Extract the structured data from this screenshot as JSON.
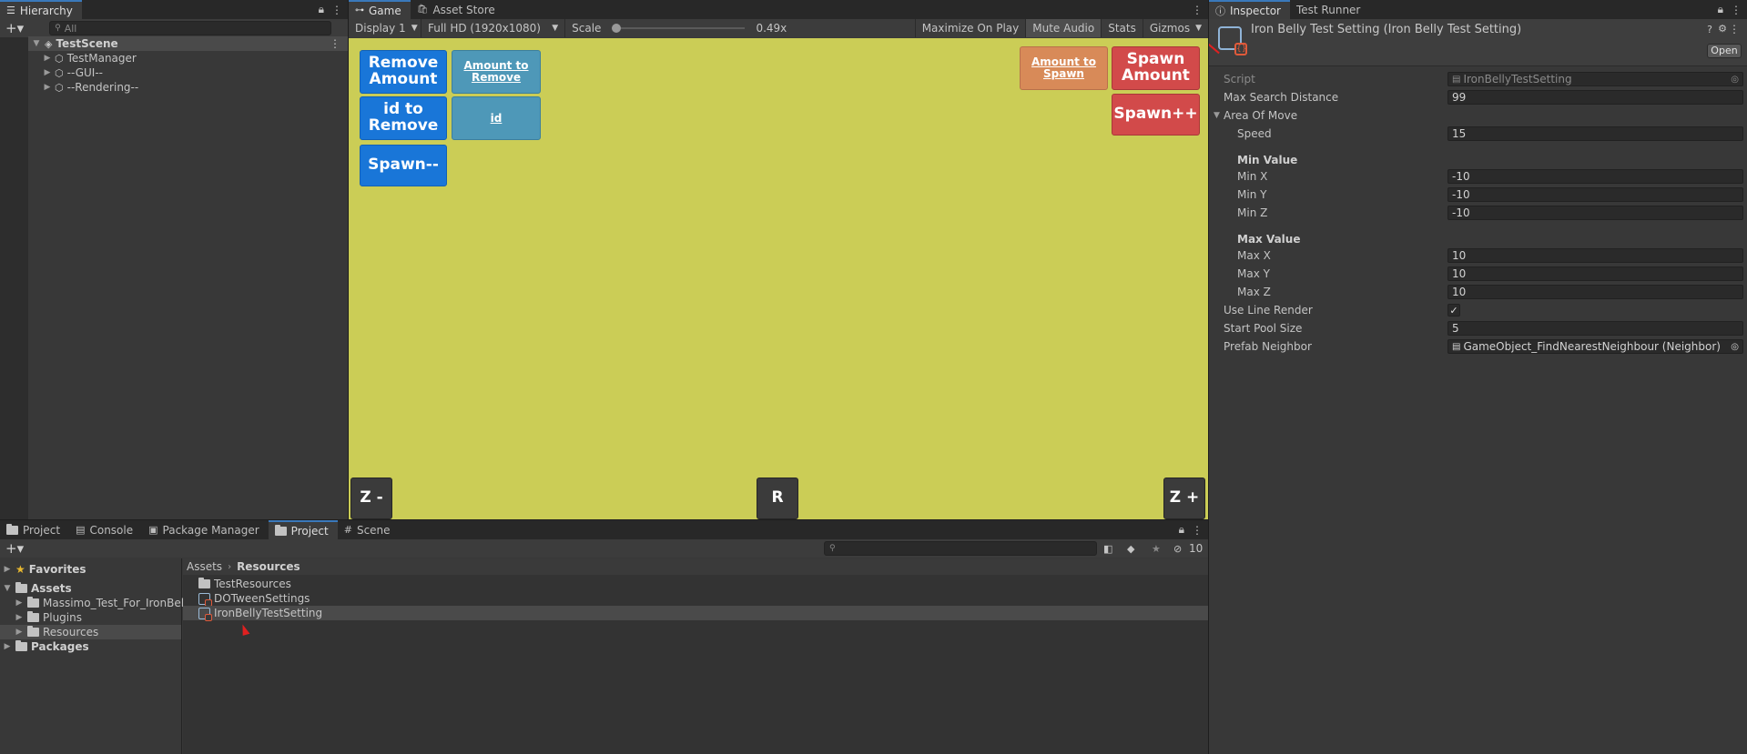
{
  "hierarchy": {
    "tab_label": "Hierarchy",
    "search_placeholder": "All",
    "items": [
      {
        "label": "TestScene"
      },
      {
        "label": "TestManager"
      },
      {
        "label": "--GUI--"
      },
      {
        "label": "--Rendering--"
      }
    ]
  },
  "game": {
    "tabs": [
      {
        "label": "Game"
      },
      {
        "label": "Asset Store"
      }
    ],
    "toolbar": {
      "display": "Display 1",
      "resolution": "Full HD (1920x1080)",
      "scale_label": "Scale",
      "scale_value": "0.49x",
      "maximize": "Maximize On Play",
      "mute": "Mute Audio",
      "stats": "Stats",
      "gizmos": "Gizmos"
    },
    "buttons": {
      "remove_amount": "Remove Amount",
      "amount_to_remove": "Amount to Remove",
      "id_to_remove": "id to Remove",
      "id": "id",
      "spawn_minus": "Spawn--",
      "amount_to_spawn": "Amount to Spawn",
      "spawn_amount": "Spawn Amount",
      "spawn_plus": "Spawn++",
      "zoom_out": "Z -",
      "reset": "R",
      "zoom_in": "Z +"
    },
    "background_color": "#cbcd56"
  },
  "project": {
    "tabs": [
      {
        "label": "Project"
      },
      {
        "label": "Console"
      },
      {
        "label": "Package Manager"
      },
      {
        "label": "Project"
      },
      {
        "label": "Scene"
      }
    ],
    "hidden_count": "10",
    "sidebar": {
      "favorites": "Favorites",
      "assets": "Assets",
      "asset_children": [
        {
          "label": "Massimo_Test_For_IronBell"
        },
        {
          "label": "Plugins"
        },
        {
          "label": "Resources"
        }
      ],
      "packages": "Packages"
    },
    "breadcrumb": {
      "root": "Assets",
      "current": "Resources"
    },
    "files": [
      {
        "label": "TestResources",
        "icon": "folder-icon"
      },
      {
        "label": "DOTweenSettings",
        "icon": "scriptable-object-icon"
      },
      {
        "label": "IronBellyTestSetting",
        "icon": "scriptable-object-icon"
      }
    ]
  },
  "inspector": {
    "tabs": [
      {
        "label": "Inspector"
      },
      {
        "label": "Test Runner"
      }
    ],
    "title": "Iron Belly Test Setting (Iron Belly Test Setting)",
    "open_label": "Open",
    "script_label": "Script",
    "script_value": "IronBellyTestSetting",
    "max_search_distance_label": "Max Search Distance",
    "max_search_distance": "99",
    "area_of_move_label": "Area Of Move",
    "speed_label": "Speed",
    "speed": "15",
    "min_value_label": "Min Value",
    "min_x_label": "Min X",
    "min_x": "-10",
    "min_y_label": "Min Y",
    "min_y": "-10",
    "min_z_label": "Min Z",
    "min_z": "-10",
    "max_value_label": "Max Value",
    "max_x_label": "Max X",
    "max_x": "10",
    "max_y_label": "Max Y",
    "max_y": "10",
    "max_z_label": "Max Z",
    "max_z": "10",
    "use_line_render_label": "Use Line Render",
    "use_line_render": "✓",
    "start_pool_size_label": "Start Pool Size",
    "start_pool_size": "5",
    "prefab_neighbor_label": "Prefab Neighbor",
    "prefab_neighbor": "GameObject_FindNearestNeighbour (Neighbor)"
  }
}
